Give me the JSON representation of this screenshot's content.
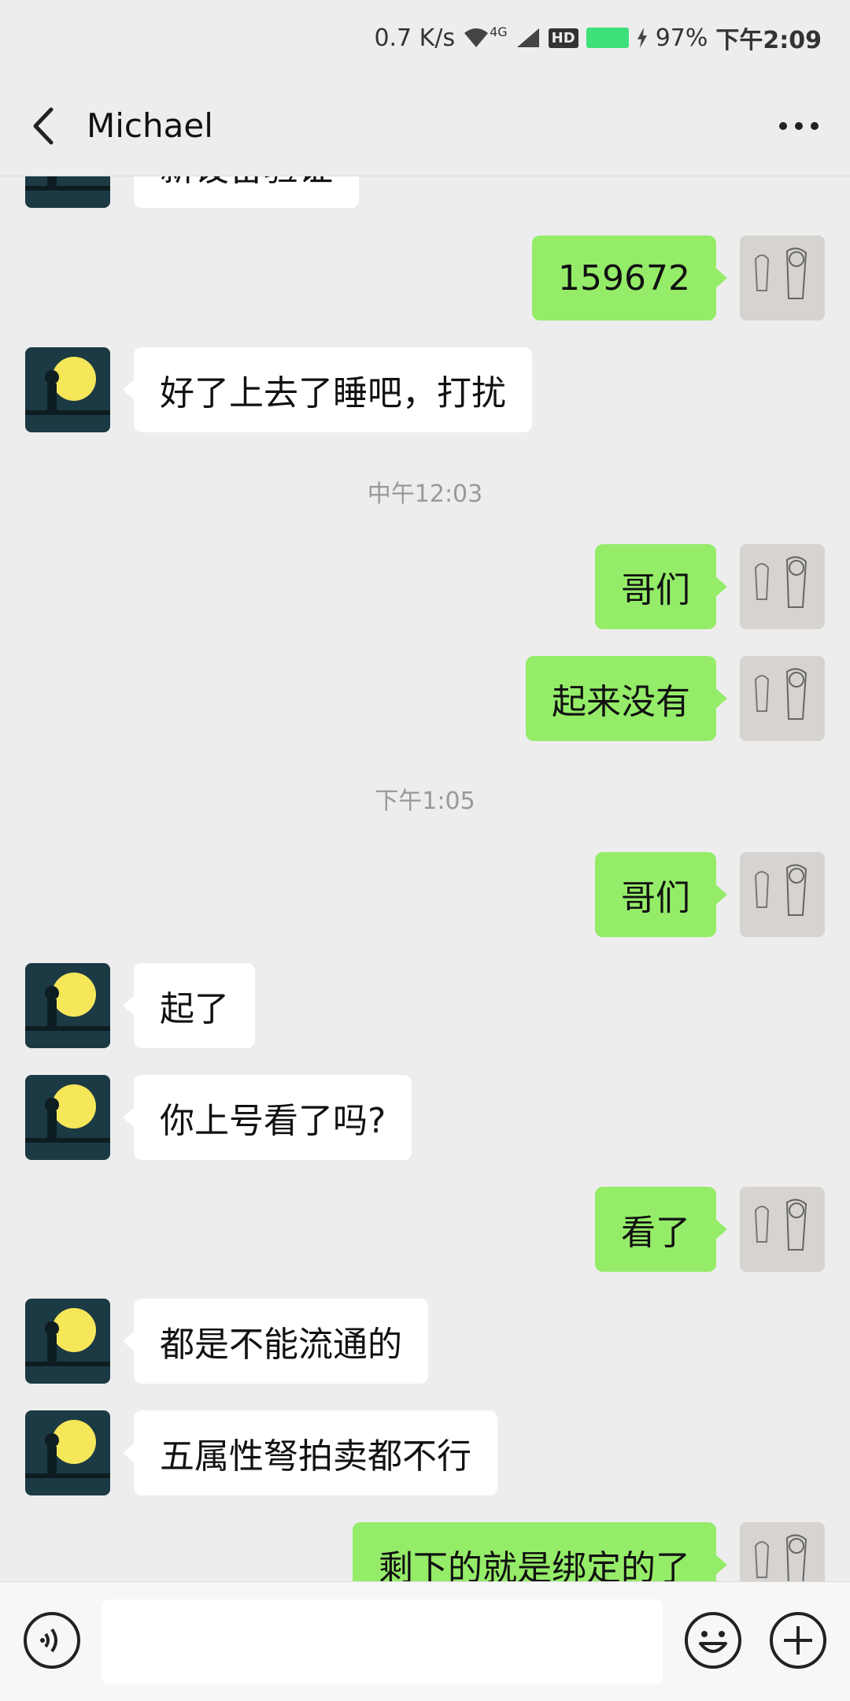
{
  "status_bar": {
    "speed": "0.7 K/s",
    "network": "4G",
    "hd": "HD",
    "battery": "97%",
    "time": "下午2:09"
  },
  "nav": {
    "title": "Michael"
  },
  "messages": [
    {
      "side": "in",
      "text": "新设备验证"
    },
    {
      "side": "out",
      "text": "159672"
    },
    {
      "side": "in",
      "text": "好了上去了睡吧，打扰"
    },
    {
      "side": "time",
      "text": "中午12:03"
    },
    {
      "side": "out",
      "text": "哥们"
    },
    {
      "side": "out",
      "text": "起来没有"
    },
    {
      "side": "time",
      "text": "下午1:05"
    },
    {
      "side": "out",
      "text": "哥们"
    },
    {
      "side": "in",
      "text": "起了"
    },
    {
      "side": "in",
      "text": "你上号看了吗?"
    },
    {
      "side": "out",
      "text": "看了"
    },
    {
      "side": "in",
      "text": "都是不能流通的"
    },
    {
      "side": "in",
      "text": "五属性弩拍卖都不行"
    },
    {
      "side": "out",
      "text": "剩下的就是绑定的了"
    }
  ],
  "colors": {
    "background": "#ededed",
    "outgoing_bubble": "#95ec69",
    "incoming_bubble": "#ffffff",
    "battery": "#3ee07a"
  }
}
